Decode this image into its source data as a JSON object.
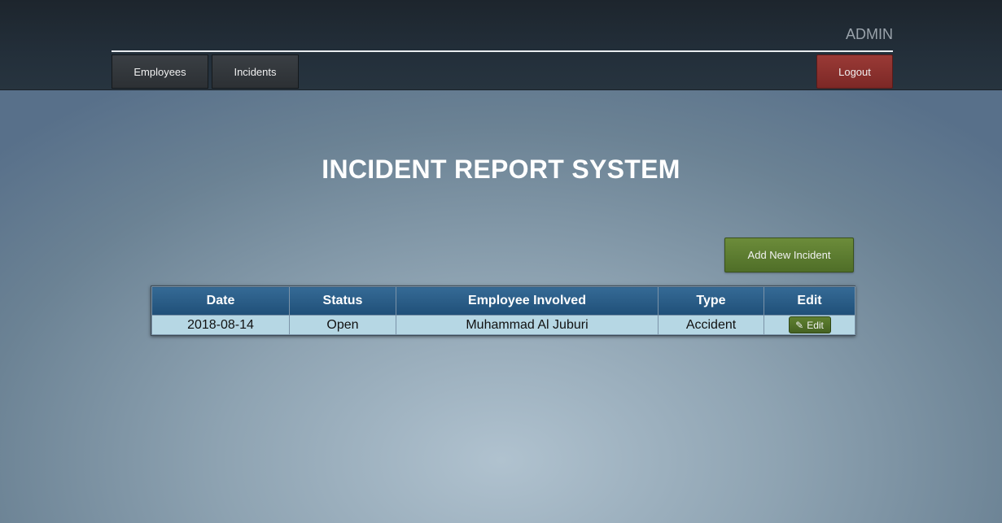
{
  "header": {
    "user_label": "ADMIN",
    "nav": {
      "employees": "Employees",
      "incidents": "Incidents",
      "logout": "Logout"
    }
  },
  "main": {
    "title": "INCIDENT REPORT SYSTEM",
    "add_button_label": "Add New Incident",
    "table": {
      "columns": [
        "Date",
        "Status",
        "Employee Involved",
        "Type",
        "Edit"
      ],
      "rows": [
        {
          "date": "2018-08-14",
          "status": "Open",
          "employee": "Muhammad Al Juburi",
          "type": "Accident",
          "edit_icon": "✎",
          "edit_label": "Edit"
        }
      ]
    }
  },
  "colors": {
    "nav_bar": "#232f3a",
    "logout": "#8a302d",
    "add_button": "#5e7e31",
    "table_header": "#2a5b85",
    "table_row": "#b6d7e4"
  },
  "icons": {
    "edit": "pencil-icon"
  }
}
